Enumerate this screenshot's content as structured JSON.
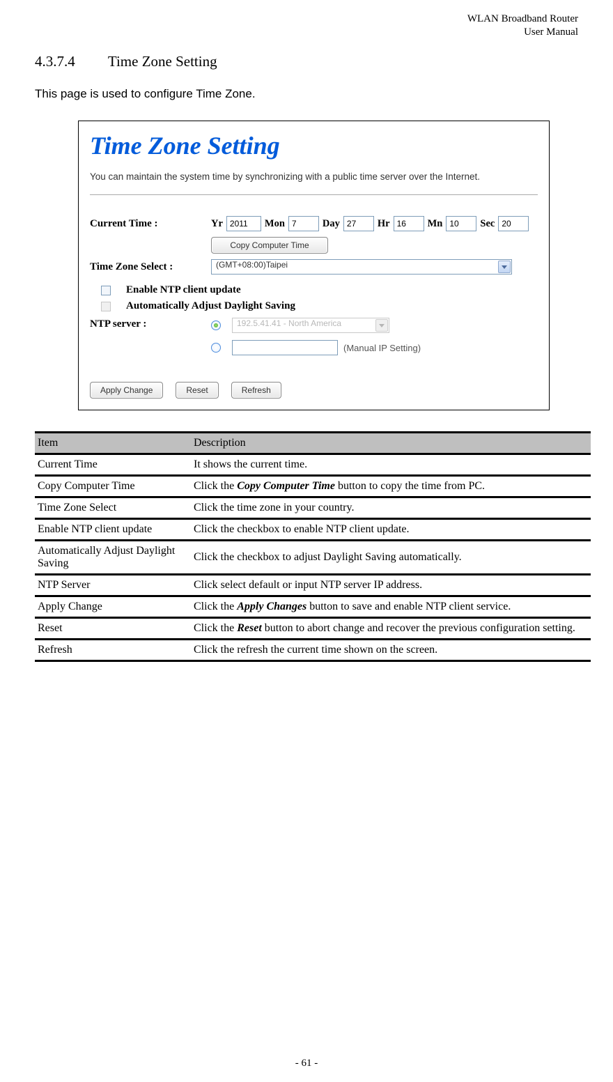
{
  "doc_header_l1": "WLAN  Broadband  Router",
  "doc_header_l2": "User  Manual",
  "section_number": "4.3.7.4",
  "section_title": "Time Zone Setting",
  "intro": "This page is used to configure Time Zone.",
  "panel": {
    "title": "Time Zone Setting",
    "subtitle": "You can maintain the system time by synchronizing with a public time server over the Internet.",
    "labels": {
      "current_time": "Current Time :",
      "yr": "Yr",
      "mon": "Mon",
      "day": "Day",
      "hr": "Hr",
      "mn": "Mn",
      "sec": "Sec",
      "copy_btn": "Copy Computer Time",
      "tz_select": "Time Zone Select :",
      "enable_ntp": "Enable NTP client update",
      "auto_dst": "Automatically Adjust Daylight Saving",
      "ntp_server": "NTP server :",
      "manual_ip": "(Manual IP Setting)",
      "apply": "Apply Change",
      "reset": "Reset",
      "refresh": "Refresh"
    },
    "values": {
      "yr": "2011",
      "mon": "7",
      "day": "27",
      "hr": "16",
      "mn": "10",
      "sec": "20",
      "tz": "(GMT+08:00)Taipei",
      "ntp_dropdown": "192.5.41.41 - North America"
    }
  },
  "table": {
    "head_item": "Item",
    "head_desc": "Description",
    "rows": [
      {
        "item": "Current Time",
        "desc": "It shows the current time."
      },
      {
        "item": "Copy Computer Time",
        "desc": "Click the <em>Copy Computer Time</em> button to copy the time from PC."
      },
      {
        "item": "Time Zone Select",
        "desc": "Click the time zone in your country."
      },
      {
        "item": "Enable NTP client update",
        "desc": "Click the checkbox to enable NTP client update."
      },
      {
        "item": "Automatically Adjust Daylight Saving",
        "desc": "Click the checkbox to adjust Daylight Saving automatically."
      },
      {
        "item": "NTP Server",
        "desc": "Click select default or input NTP server IP address."
      },
      {
        "item": "Apply Change",
        "desc": "Click the <em>Apply Changes</em> button to save and enable NTP client service."
      },
      {
        "item": "Reset",
        "desc": "Click the <em>Reset</em> button to abort change and recover the previous configuration setting."
      },
      {
        "item": "Refresh",
        "desc": "Click the refresh the current time shown on the screen."
      }
    ]
  },
  "page_footer": "- 61 -"
}
